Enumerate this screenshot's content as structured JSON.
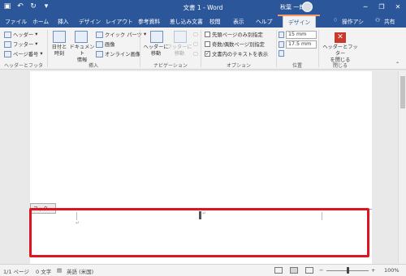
{
  "titlebar": {
    "title": "文書 1 - Word",
    "user": "秋葉 一郎",
    "save_icon": "save-icon",
    "undo_icon": "undo-icon",
    "redo_icon": "redo-icon",
    "customize_icon": "customize-qat-icon",
    "minimize": "─",
    "restore": "❐",
    "close": "✕"
  },
  "tabs": [
    "ファイル",
    "ホーム",
    "挿入",
    "デザイン",
    "レイアウト",
    "参考資料",
    "差し込み文書",
    "校閲",
    "表示",
    "ヘルプ",
    "デザイン"
  ],
  "tell_me": "操作アシ",
  "share": "共有",
  "ribbon": {
    "header_footer": {
      "header": "ヘッダー",
      "footer": "フッター",
      "page_number": "ページ番号",
      "label": "ヘッダーとフッター"
    },
    "insert": {
      "date_time": [
        "日付と",
        "時刻"
      ],
      "doc_info": [
        "ドキュメント",
        "情報"
      ],
      "quick_parts": "クイック パーツ",
      "picture": "画像",
      "online_picture": "オンライン画像",
      "label": "挿入"
    },
    "navigation": {
      "go_header": [
        "ヘッダーに",
        "移動"
      ],
      "go_footer": [
        "フッターに",
        "移動"
      ],
      "label": "ナビゲーション"
    },
    "options": {
      "first_page": "先頭ページのみ別指定",
      "odd_even": "奇数/偶数ページ別指定",
      "show_text": "文書内のテキストを表示",
      "label": "オプション"
    },
    "position": {
      "header_pos": "15 mm",
      "footer_pos": "17.5 mm",
      "label": "位置"
    },
    "close": {
      "button": [
        "ヘッダーとフッター",
        "を閉じる"
      ],
      "label": "閉じる"
    }
  },
  "document": {
    "footer_tag": "フッター",
    "para_mark": "↵"
  },
  "statusbar": {
    "page": "1/1 ページ",
    "words": "0 文字",
    "language": "英語 (米国)",
    "zoom": "100%",
    "minus": "−",
    "plus": "+"
  },
  "colors": {
    "brand": "#2b579a",
    "highlight": "#e0141e",
    "close_button": "#c8392b"
  }
}
